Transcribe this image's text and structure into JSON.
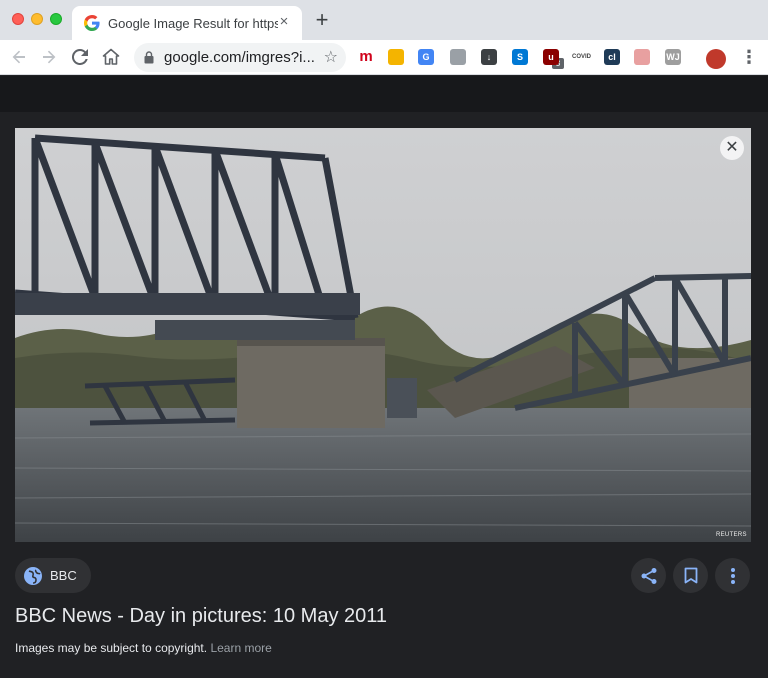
{
  "browser": {
    "tab_title": "Google Image Result for https:/",
    "tab_close": "×",
    "new_tab": "+",
    "url": "google.com/imgres?i...",
    "extensions": [
      {
        "icon": "mendeley-extension-icon",
        "text": "m",
        "color": "#d0021b"
      },
      {
        "icon": "bookmark-color-extension-icon",
        "text": "",
        "color": "#f4b400"
      },
      {
        "icon": "google-translate-extension-icon",
        "text": "G",
        "color": "#4285f4"
      },
      {
        "icon": "triangle-extension-icon",
        "text": "",
        "color": "#9aa0a6"
      },
      {
        "icon": "download-extension-icon",
        "text": "↓",
        "color": "#3c4043"
      },
      {
        "icon": "skype-extension-icon",
        "text": "S",
        "color": "#0078d4"
      },
      {
        "icon": "ublock-extension-icon",
        "text": "u",
        "color": "#8b0000"
      },
      {
        "icon": "covid-extension-icon",
        "text": "COVID",
        "color": "#ffffff"
      },
      {
        "icon": "cl-extension-icon",
        "text": "cl",
        "color": "#1f3b57"
      },
      {
        "icon": "wheel-extension-icon",
        "text": "",
        "color": "#e8a0a0"
      },
      {
        "icon": "wj-extension-icon",
        "text": "WJ",
        "color": "#9e9e9e"
      },
      {
        "icon": "profile-avatar-icon",
        "text": "",
        "color": "#c0392b"
      }
    ],
    "ublock_badge": "3"
  },
  "viewer": {
    "source_name": "BBC",
    "title": "BBC News - Day in pictures: 10 May 2011",
    "copyright_text": "Images may be subject to copyright.",
    "learn_more": "Learn more",
    "photo_credit": "REUTERS"
  },
  "colors": {
    "page_bg": "#202124",
    "chip_bg": "#303134",
    "accent_blue": "#8ab4f8"
  }
}
